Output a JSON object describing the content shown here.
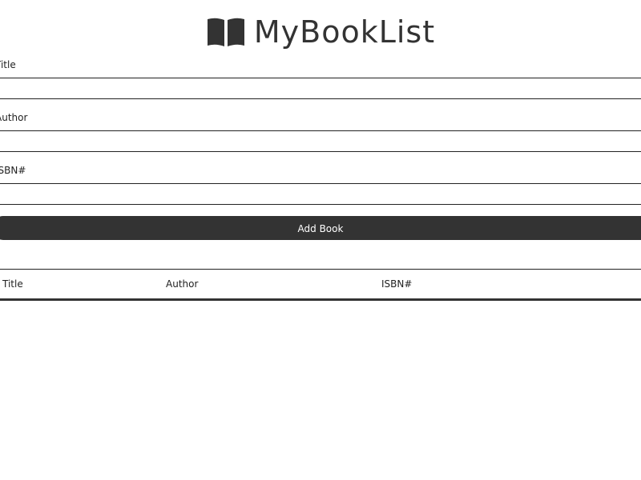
{
  "header": {
    "title": "MyBookList",
    "icon": "book-open-icon"
  },
  "form": {
    "title_label": "Title",
    "title_value": "",
    "author_label": "Author",
    "author_value": "",
    "isbn_label": "ISBN#",
    "isbn_value": "",
    "submit_label": "Add Book"
  },
  "table": {
    "headers": [
      "Title",
      "Author",
      "ISBN#"
    ],
    "rows": []
  },
  "colors": {
    "primary": "#333333",
    "background": "#ffffff",
    "text": "#222222"
  }
}
